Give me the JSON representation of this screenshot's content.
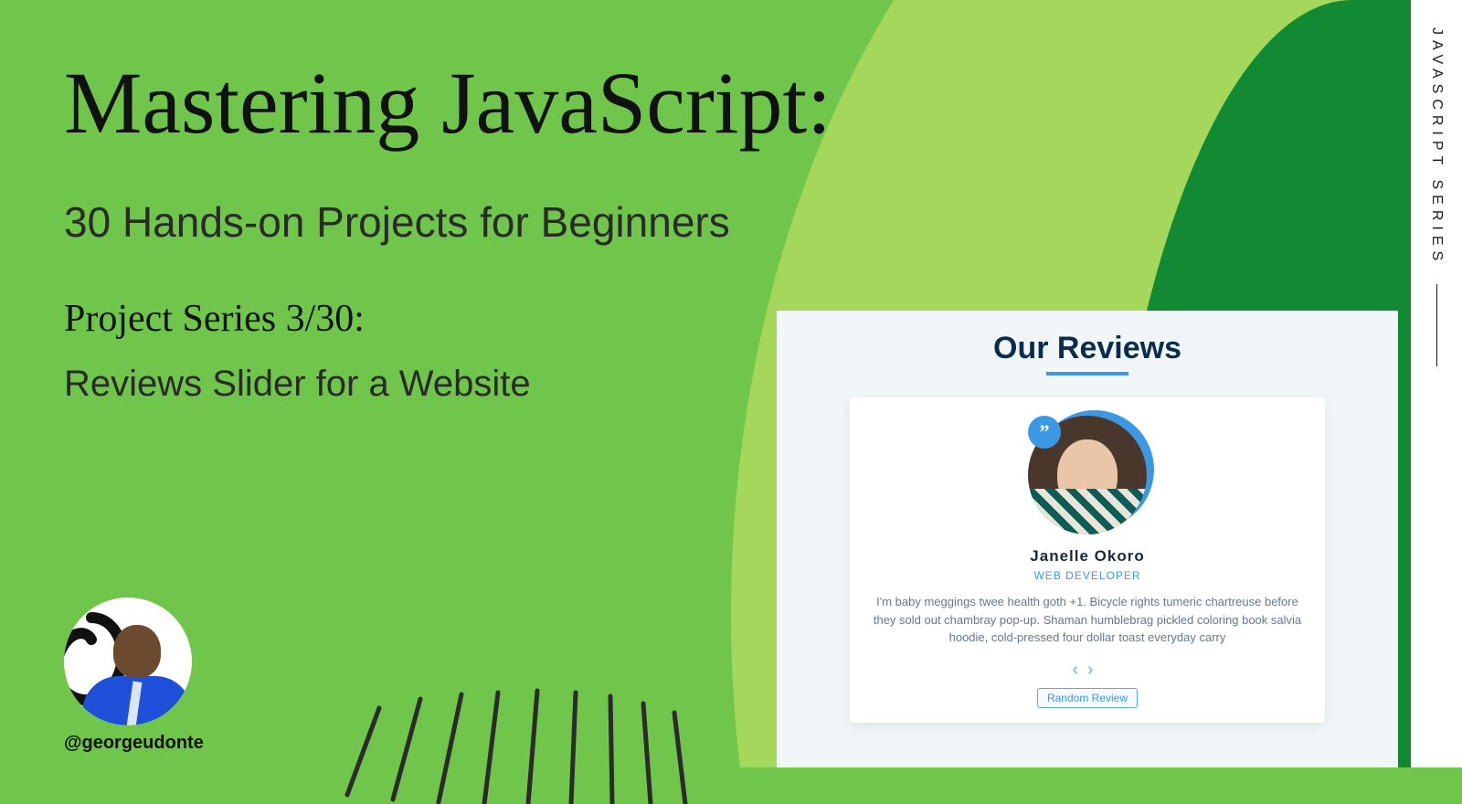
{
  "sidebar_label": "JAVASCRIPT SERIES",
  "title": "Mastering JavaScript:",
  "subtitle": "30 Hands-on Projects for Beginners",
  "series_label": "Project Series 3/30:",
  "project_name": "Reviews Slider for a Website",
  "author_handle": "@georgeudonte",
  "preview": {
    "heading": "Our Reviews",
    "name": "Janelle Okoro",
    "role": "WEB DEVELOPER",
    "text": "I'm baby meggings twee health goth +1. Bicycle rights tumeric chartreuse before they sold out chambray pop-up. Shaman humblebrag pickled coloring book salvia hoodie, cold-pressed four dollar toast everyday carry",
    "random_button": "Random Review",
    "quote_glyph": "”"
  }
}
